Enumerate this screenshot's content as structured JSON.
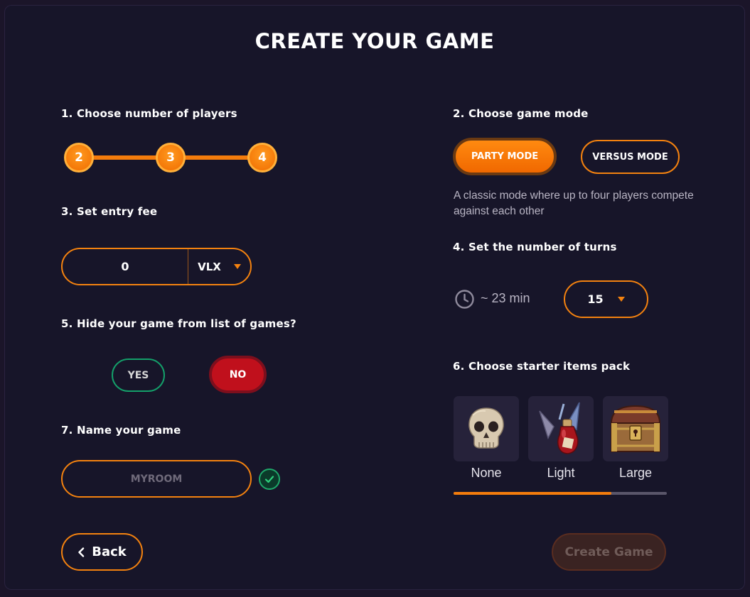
{
  "title": "CREATE YOUR GAME",
  "sections": {
    "players": "1. Choose number of players",
    "entry_fee": "3. Set entry fee",
    "hide_game": "5. Hide your game from list of games?",
    "name_game": "7. Name your game",
    "game_mode": "2. Choose game mode",
    "turns": "4. Set the number of turns",
    "starter_pack": "6. Choose starter items pack"
  },
  "players": {
    "options": [
      "2",
      "3",
      "4"
    ],
    "selected": "4"
  },
  "entry_fee": {
    "value": "0",
    "currency": "VLX"
  },
  "hide_game": {
    "yes_label": "YES",
    "no_label": "NO",
    "selected": "NO"
  },
  "name": {
    "placeholder": "MYROOM",
    "valid": true
  },
  "modes": {
    "party_label": "PARTY MODE",
    "versus_label": "VERSUS MODE",
    "selected": "PARTY MODE",
    "description": "A classic mode where up to four players compete against each other"
  },
  "turns": {
    "time": "~ 23 min",
    "value": "15"
  },
  "packs": {
    "items": [
      {
        "label": "None",
        "icon": "skull-icon"
      },
      {
        "label": "Light",
        "icon": "potion-icon"
      },
      {
        "label": "Large",
        "icon": "treasure-chest-icon"
      }
    ],
    "scroll_fraction": 0.74
  },
  "footer": {
    "back_label": "Back",
    "create_label": "Create Game"
  },
  "colors": {
    "accent": "#f4820f",
    "yes": "#14a06a",
    "no": "#c0101c",
    "background": "#171529"
  }
}
